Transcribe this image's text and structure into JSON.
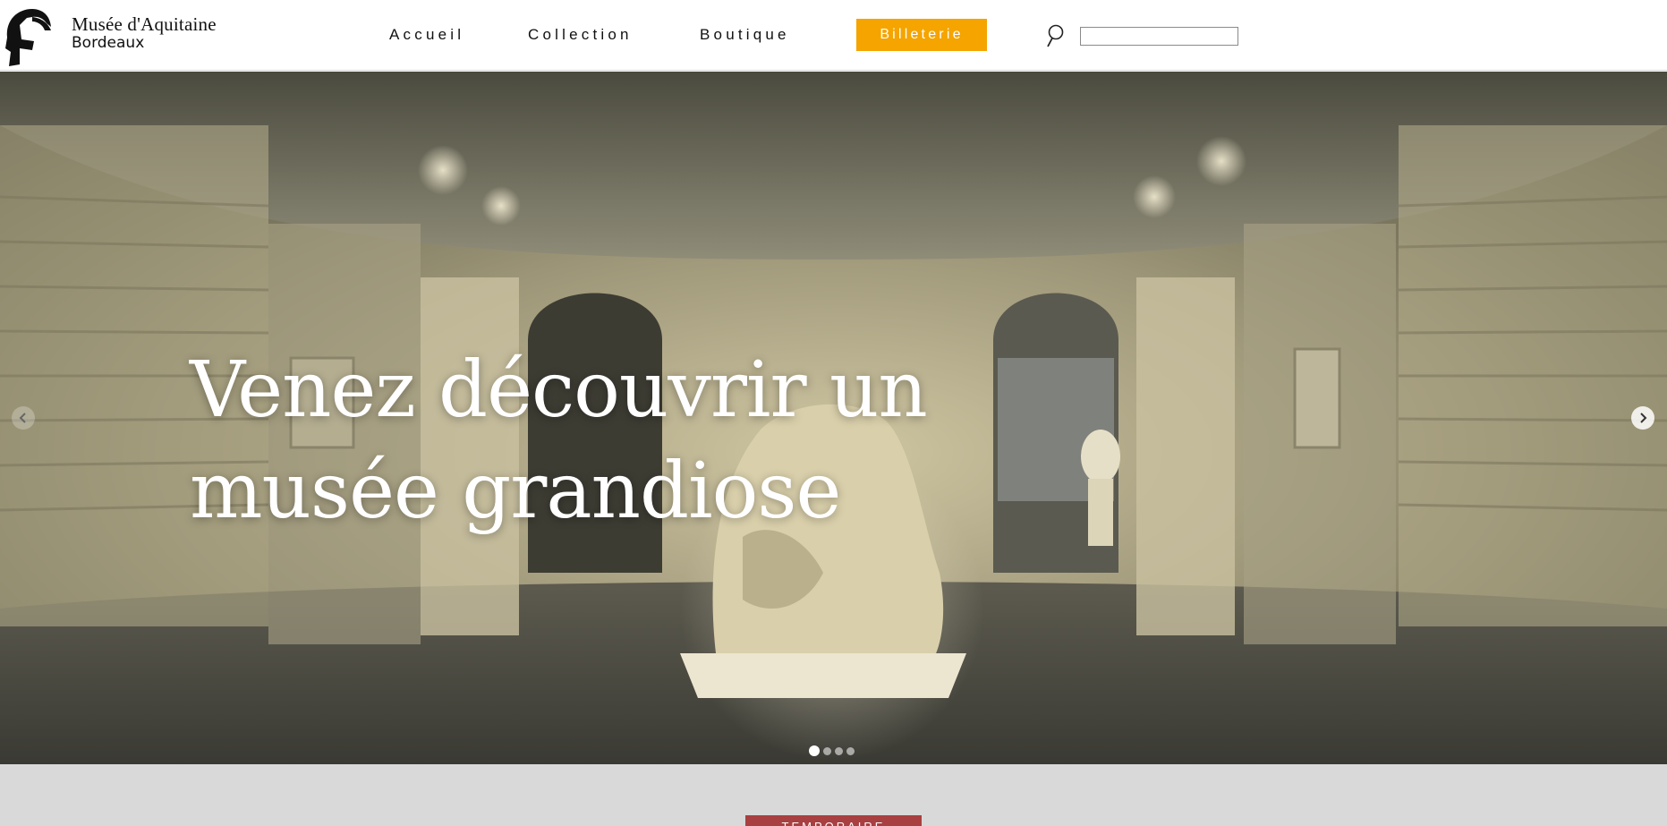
{
  "header": {
    "brand_line1": "Musée d'Aquitaine",
    "brand_line2": "Bordeaux",
    "nav": {
      "accueil": "Accueil",
      "collection": "Collection",
      "boutique": "Boutique"
    },
    "cta_label": "Billeterie",
    "search": {
      "value": "",
      "icon": "search-icon"
    }
  },
  "hero": {
    "title_line1": "Venez découvrir un",
    "title_line2": "musée grandiose",
    "carousel": {
      "slide_count": 4,
      "active_index": 0
    },
    "icons": {
      "prev": "chevron-left-icon",
      "next": "chevron-right-icon"
    }
  },
  "colors": {
    "accent": "#f5a400",
    "badge": "#a84041",
    "section_bg": "#d9d9d9"
  },
  "section": {
    "badge_label": "TEMPORAIRE"
  }
}
